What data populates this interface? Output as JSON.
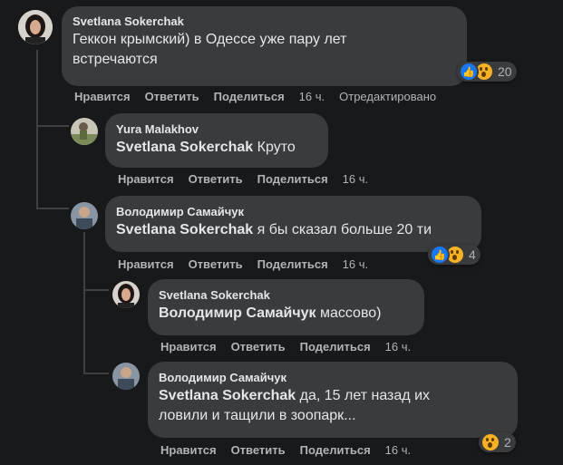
{
  "actions": {
    "like": "Нравится",
    "reply": "Ответить",
    "share": "Поделиться"
  },
  "comments": [
    {
      "author": "Svetlana Sokerchak",
      "text_lines": [
        "Геккон крымский) в Одессе уже пару лет",
        "встречаются"
      ],
      "time": "16 ч.",
      "edited": "Отредактировано",
      "reactions": {
        "icons": [
          "like",
          "wow"
        ],
        "count": "20"
      }
    },
    {
      "author": "Yura Malakhov",
      "mention": "Svetlana Sokerchak",
      "text": " Круто",
      "time": "16 ч."
    },
    {
      "author": "Володимир Самайчук",
      "mention": "Svetlana Sokerchak",
      "text": " я бы сказал больше 20 ти",
      "time": "16 ч.",
      "reactions": {
        "icons": [
          "like",
          "wow"
        ],
        "count": "4"
      }
    },
    {
      "author": "Svetlana Sokerchak",
      "mention": "Володимир Самайчук",
      "text": " массово)",
      "time": "16 ч."
    },
    {
      "author": "Володимир Самайчук",
      "mention": "Svetlana Sokerchak",
      "text_line1": " да, 15 лет назад их",
      "text_line2": "ловили и тащили в зоопарк...",
      "time": "16 ч.",
      "reactions": {
        "icons": [
          "wow"
        ],
        "count": "2"
      }
    }
  ]
}
